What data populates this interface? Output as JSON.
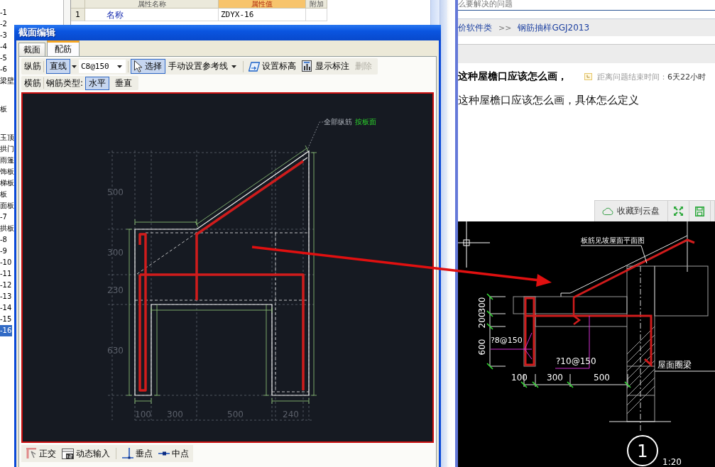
{
  "tree": {
    "groups": [
      {
        "items": [
          {
            "label": "-1",
            "selected": false
          },
          {
            "label": "-2",
            "selected": false
          },
          {
            "label": "-3",
            "selected": false
          },
          {
            "label": "-4",
            "selected": false
          },
          {
            "label": "-5",
            "selected": false
          },
          {
            "label": "-6",
            "selected": false
          },
          {
            "label": "梁壁",
            "selected": false
          }
        ]
      },
      {
        "items": [
          {
            "label": "板",
            "selected": false
          }
        ]
      },
      {
        "items": [
          {
            "label": "玉顶",
            "selected": false
          },
          {
            "label": "拱门",
            "selected": false
          },
          {
            "label": "雨篷",
            "selected": false
          },
          {
            "label": "饰板",
            "selected": false
          },
          {
            "label": "梯板",
            "selected": false
          },
          {
            "label": "板",
            "selected": false
          },
          {
            "label": "面板",
            "selected": false
          },
          {
            "label": "-7",
            "selected": false
          },
          {
            "label": "拱板",
            "selected": false
          },
          {
            "label": "-8",
            "selected": false
          },
          {
            "label": "-9",
            "selected": false
          },
          {
            "label": "-10",
            "selected": false
          },
          {
            "label": "-11",
            "selected": false
          },
          {
            "label": "-12",
            "selected": false
          },
          {
            "label": "-13",
            "selected": false
          },
          {
            "label": "-14",
            "selected": false
          },
          {
            "label": "-15",
            "selected": false
          },
          {
            "label": "-16",
            "selected": true
          }
        ]
      }
    ]
  },
  "property_table": {
    "columns": [
      {
        "label": "属性名称",
        "selected": false
      },
      {
        "label": "属性值",
        "selected": true
      },
      {
        "label": "附加",
        "selected": false
      }
    ],
    "rows": [
      {
        "index": "1",
        "name": "名称",
        "value": "ZDYX-16"
      }
    ]
  },
  "dialog": {
    "title": "截面编辑",
    "tabs": [
      {
        "label": "截面",
        "selected": false
      },
      {
        "label": "配筋",
        "selected": true
      }
    ],
    "longitudinal_toolbar": {
      "label": "纵筋",
      "shape": {
        "label": "直线",
        "selected": true
      },
      "spec": {
        "value": "C8@150"
      },
      "select_tool": {
        "label": "选择",
        "selected": true
      },
      "guide_menu": {
        "label": "手动设置参考线"
      },
      "elevation_button": {
        "label": "设置标高"
      },
      "labels_button": {
        "label": "显示标注"
      },
      "delete_button": {
        "label": "删除",
        "disabled": true
      }
    },
    "transverse_toolbar": {
      "label": "横筋",
      "type_label": "钢筋类型:",
      "types": [
        {
          "label": "水平",
          "selected": true
        },
        {
          "label": "垂直",
          "selected": false
        }
      ]
    },
    "section_drawing": {
      "left_dimensions": [
        "500",
        "300",
        "230",
        "630"
      ],
      "bottom_dimensions": [
        "100",
        "300",
        "500",
        "240"
      ],
      "note": "全部纵筋",
      "note_value": "按板面"
    },
    "snap_toolbar": [
      {
        "kind": "ortho",
        "label": "正交"
      },
      {
        "kind": "input",
        "label": "动态输入"
      },
      {
        "kind": "perpendicular",
        "label": "垂点"
      },
      {
        "kind": "midpoint",
        "label": "中点"
      }
    ]
  },
  "web_page": {
    "top_text": "么要解决的问题",
    "breadcrumb": {
      "parent": "价软件类",
      "separator": ">>",
      "current": "钢筋抽样GGJ2013"
    },
    "question": {
      "title": "这种屋檐口应该怎么画，",
      "deadline_label": "距离问题结束时间：",
      "deadline": "6天22小时",
      "body": "这种屋檐口应该怎么画，具体怎么定义"
    },
    "image_actions": {
      "save_to_cloud": "收藏到云盘"
    },
    "detail_drawing": {
      "note": "板筋见坡屋面平面图",
      "beam_label": "屋面圈梁",
      "stirrup_label": "?8@150",
      "bar_label": "?10@150",
      "vertical_dimensions": [
        "300",
        "200",
        "600"
      ],
      "horizontal_dimensions": [
        "100",
        "300",
        "500"
      ],
      "section_number": "1",
      "scale": "1:20"
    }
  }
}
